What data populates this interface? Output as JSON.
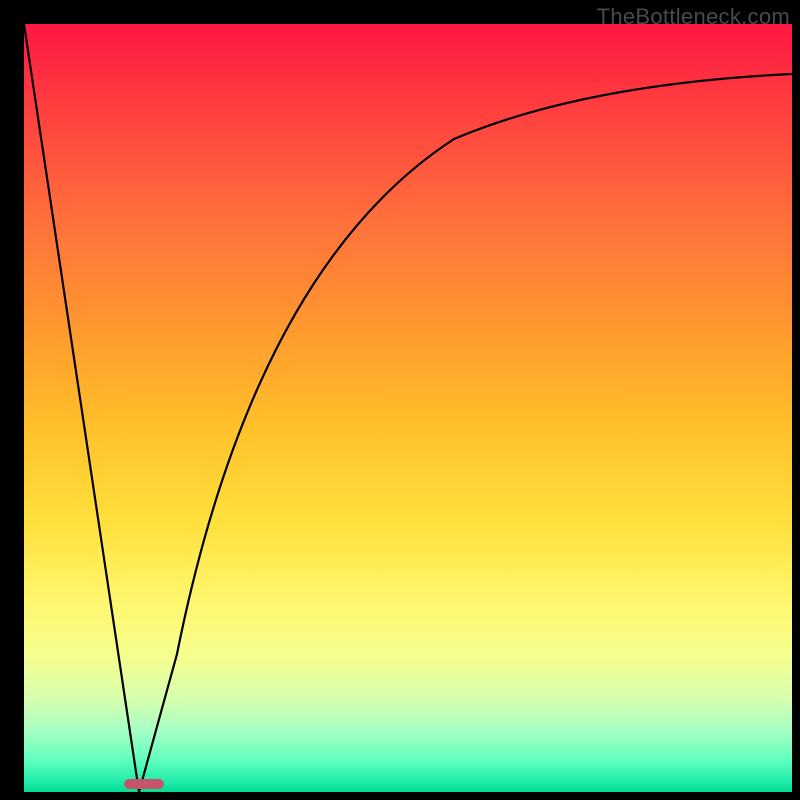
{
  "watermark": "TheBottleneck.com",
  "colors": {
    "frame": "#000000",
    "curve": "#000000",
    "marker": "#c4546a",
    "gradient_top": "#ff1744",
    "gradient_bottom": "#02d98e"
  },
  "chart_data": {
    "type": "line",
    "title": "",
    "xlabel": "",
    "ylabel": "",
    "xlim": [
      0,
      100
    ],
    "ylim": [
      0,
      100
    ],
    "series": [
      {
        "name": "left-line",
        "x": [
          0,
          15
        ],
        "values": [
          100,
          0
        ]
      },
      {
        "name": "right-curve",
        "x": [
          15,
          20,
          25,
          30,
          35,
          40,
          45,
          50,
          55,
          60,
          65,
          70,
          75,
          80,
          85,
          90,
          95,
          100
        ],
        "values": [
          0,
          18,
          36,
          51,
          62,
          70,
          76,
          80,
          83.5,
          86,
          88,
          89.5,
          90.5,
          91.3,
          92,
          92.5,
          92.8,
          93
        ]
      }
    ],
    "annotations": [
      {
        "name": "minimum-marker",
        "x": 15,
        "y": 0,
        "w": 4,
        "h": 1.2
      }
    ]
  }
}
